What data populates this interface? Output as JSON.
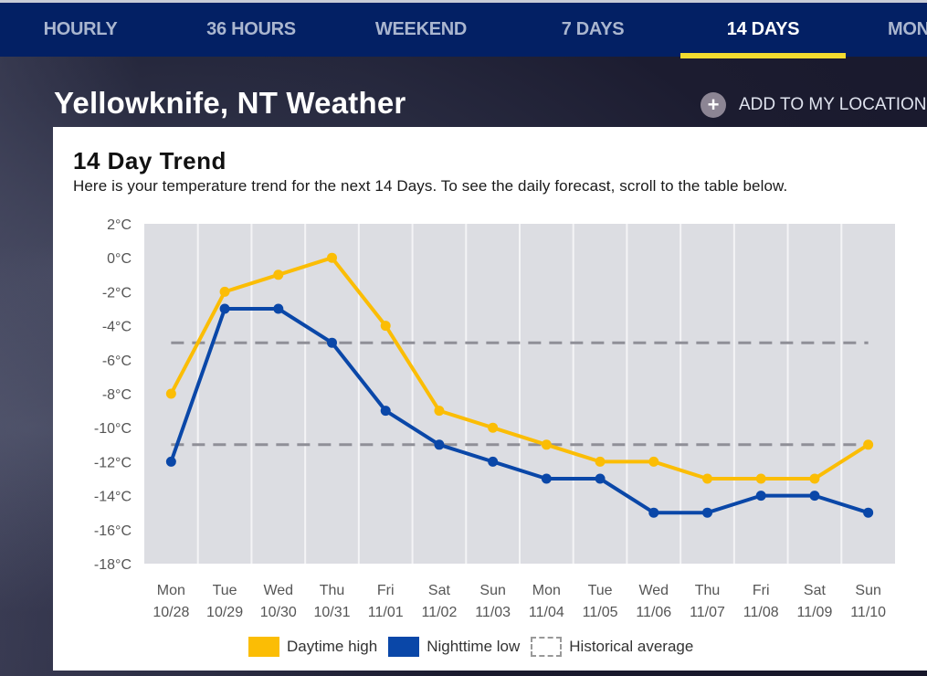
{
  "nav": {
    "tabs": [
      {
        "label": "HOURLY",
        "active": false
      },
      {
        "label": "36 HOURS",
        "active": false
      },
      {
        "label": "WEEKEND",
        "active": false
      },
      {
        "label": "7 DAYS",
        "active": false
      },
      {
        "label": "14 DAYS",
        "active": true
      },
      {
        "label": "MON",
        "active": false
      }
    ],
    "active_underline_color": "#f3dc2f"
  },
  "header": {
    "title": "Yellowknife, NT Weather",
    "add_location_label": "ADD TO MY LOCATIONS",
    "add_location_icon": "plus-circle-icon"
  },
  "card": {
    "title": "14 Day Trend",
    "subtitle": "Here is your temperature trend for the next 14 Days. To see the daily forecast, scroll to the table below."
  },
  "legend": {
    "high_label": "Daytime high",
    "low_label": "Nighttime low",
    "avg_label": "Historical average"
  },
  "chart_data": {
    "type": "line",
    "title": "14 Day Trend",
    "xlabel": "",
    "ylabel": "",
    "ylim": [
      -18,
      2
    ],
    "yticks": [
      "2°C",
      "0°C",
      "-2°C",
      "-4°C",
      "-6°C",
      "-8°C",
      "-10°C",
      "-12°C",
      "-14°C",
      "-16°C",
      "-18°C"
    ],
    "ytick_values": [
      2,
      0,
      -2,
      -4,
      -6,
      -8,
      -10,
      -12,
      -14,
      -16,
      -18
    ],
    "grid": "vertical",
    "legend_position": "bottom-center",
    "categories": [
      {
        "day": "Mon",
        "date": "10/28"
      },
      {
        "day": "Tue",
        "date": "10/29"
      },
      {
        "day": "Wed",
        "date": "10/30"
      },
      {
        "day": "Thu",
        "date": "10/31"
      },
      {
        "day": "Fri",
        "date": "11/01"
      },
      {
        "day": "Sat",
        "date": "11/02"
      },
      {
        "day": "Sun",
        "date": "11/03"
      },
      {
        "day": "Mon",
        "date": "11/04"
      },
      {
        "day": "Tue",
        "date": "11/05"
      },
      {
        "day": "Wed",
        "date": "11/06"
      },
      {
        "day": "Thu",
        "date": "11/07"
      },
      {
        "day": "Fri",
        "date": "11/08"
      },
      {
        "day": "Sat",
        "date": "11/09"
      },
      {
        "day": "Sun",
        "date": "11/10"
      }
    ],
    "series": [
      {
        "name": "Daytime high",
        "color": "#fbbd05",
        "values": [
          -8,
          -2,
          -1,
          0,
          -4,
          -9,
          -10,
          -11,
          -12,
          -12,
          -13,
          -13,
          -13,
          -11
        ]
      },
      {
        "name": "Nighttime low",
        "color": "#0a47a8",
        "values": [
          -12,
          -3,
          -3,
          -5,
          -9,
          -11,
          -12,
          -13,
          -13,
          -15,
          -15,
          -14,
          -14,
          -15
        ]
      }
    ],
    "historical_average": {
      "name": "Historical average",
      "color": "#8f8f97",
      "high": -5,
      "low": -11
    },
    "plot_background": "#dcdde2"
  }
}
